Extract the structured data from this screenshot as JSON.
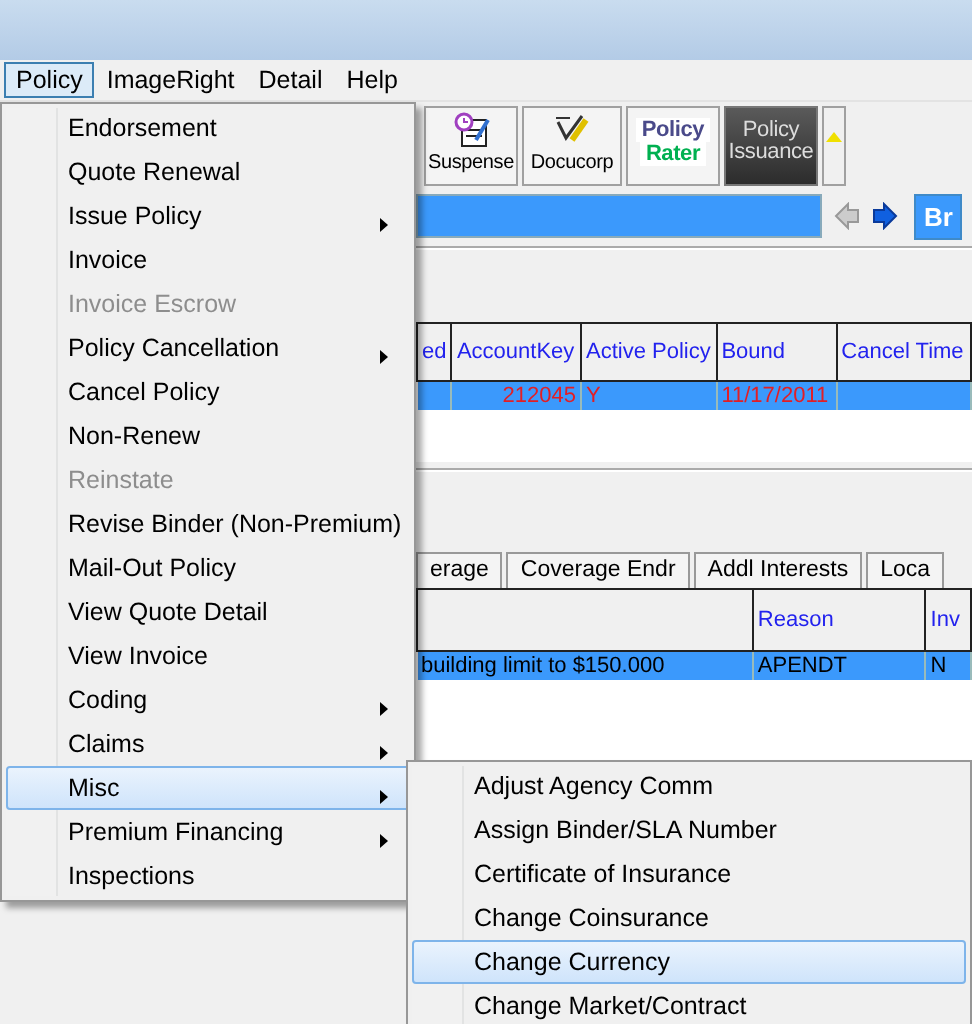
{
  "menu_bar": [
    {
      "label": "Policy",
      "selected": true
    },
    {
      "label": "ImageRight",
      "selected": false
    },
    {
      "label": "Detail",
      "selected": false
    },
    {
      "label": "Help",
      "selected": false
    }
  ],
  "toolbar": [
    {
      "kind": "suspense",
      "lines": [
        "Suspense"
      ]
    },
    {
      "kind": "docucorp",
      "lines": [
        "Docucorp"
      ]
    },
    {
      "kind": "rater",
      "lines": [
        "Policy",
        "Rater"
      ]
    },
    {
      "kind": "dark",
      "lines": [
        "Policy",
        "Issuance"
      ]
    }
  ],
  "nav": {
    "button": "Br"
  },
  "policy_table": {
    "columns": [
      "ed",
      "AccountKey",
      "Active Policy",
      "Bound",
      "Cancel Time"
    ],
    "rows": [
      {
        "selected": true,
        "cells": [
          "",
          "212045",
          "Y",
          "11/17/2011",
          ""
        ]
      }
    ]
  },
  "tabs": [
    {
      "label": "erage",
      "selected": false
    },
    {
      "label": "Coverage Endr",
      "selected": false
    },
    {
      "label": "Addl Interests",
      "selected": false
    },
    {
      "label": "Loca",
      "selected": false
    }
  ],
  "detail_table": {
    "columns": [
      "",
      "Reason",
      "Inv"
    ],
    "rows": [
      {
        "selected": true,
        "cells": [
          "building limit to $150.000",
          "APENDT",
          "N"
        ]
      }
    ]
  },
  "policy_menu": {
    "items": [
      {
        "label": "Endorsement",
        "disabled": false,
        "submenu": false,
        "selected": false
      },
      {
        "label": "Quote Renewal",
        "disabled": false,
        "submenu": false,
        "selected": false
      },
      {
        "label": "Issue Policy",
        "disabled": false,
        "submenu": true,
        "selected": false
      },
      {
        "label": "Invoice",
        "disabled": false,
        "submenu": false,
        "selected": false
      },
      {
        "label": "Invoice Escrow",
        "disabled": true,
        "submenu": false,
        "selected": false
      },
      {
        "label": "Policy Cancellation",
        "disabled": false,
        "submenu": true,
        "selected": false
      },
      {
        "label": "Cancel Policy",
        "disabled": false,
        "submenu": false,
        "selected": false
      },
      {
        "label": "Non-Renew",
        "disabled": false,
        "submenu": false,
        "selected": false
      },
      {
        "label": "Reinstate",
        "disabled": true,
        "submenu": false,
        "selected": false
      },
      {
        "label": "Revise Binder (Non-Premium)",
        "disabled": false,
        "submenu": false,
        "selected": false
      },
      {
        "label": "Mail-Out Policy",
        "disabled": false,
        "submenu": false,
        "selected": false
      },
      {
        "label": "View Quote Detail",
        "disabled": false,
        "submenu": false,
        "selected": false
      },
      {
        "label": "View Invoice",
        "disabled": false,
        "submenu": false,
        "selected": false
      },
      {
        "label": "Coding",
        "disabled": false,
        "submenu": true,
        "selected": false
      },
      {
        "label": "Claims",
        "disabled": false,
        "submenu": true,
        "selected": false
      },
      {
        "label": "Misc",
        "disabled": false,
        "submenu": true,
        "selected": true
      },
      {
        "label": "Premium Financing",
        "disabled": false,
        "submenu": true,
        "selected": false
      },
      {
        "label": "Inspections",
        "disabled": false,
        "submenu": false,
        "selected": false
      }
    ]
  },
  "misc_submenu": {
    "items": [
      {
        "label": "Adjust Agency Comm",
        "disabled": false,
        "submenu": false,
        "selected": false
      },
      {
        "label": "Assign Binder/SLA Number",
        "disabled": false,
        "submenu": false,
        "selected": false
      },
      {
        "label": "Certificate of Insurance",
        "disabled": false,
        "submenu": false,
        "selected": false
      },
      {
        "label": "Change Coinsurance",
        "disabled": false,
        "submenu": false,
        "selected": false
      },
      {
        "label": "Change Currency",
        "disabled": false,
        "submenu": false,
        "selected": true
      },
      {
        "label": "Change Market/Contract",
        "disabled": false,
        "submenu": false,
        "selected": false
      }
    ]
  }
}
